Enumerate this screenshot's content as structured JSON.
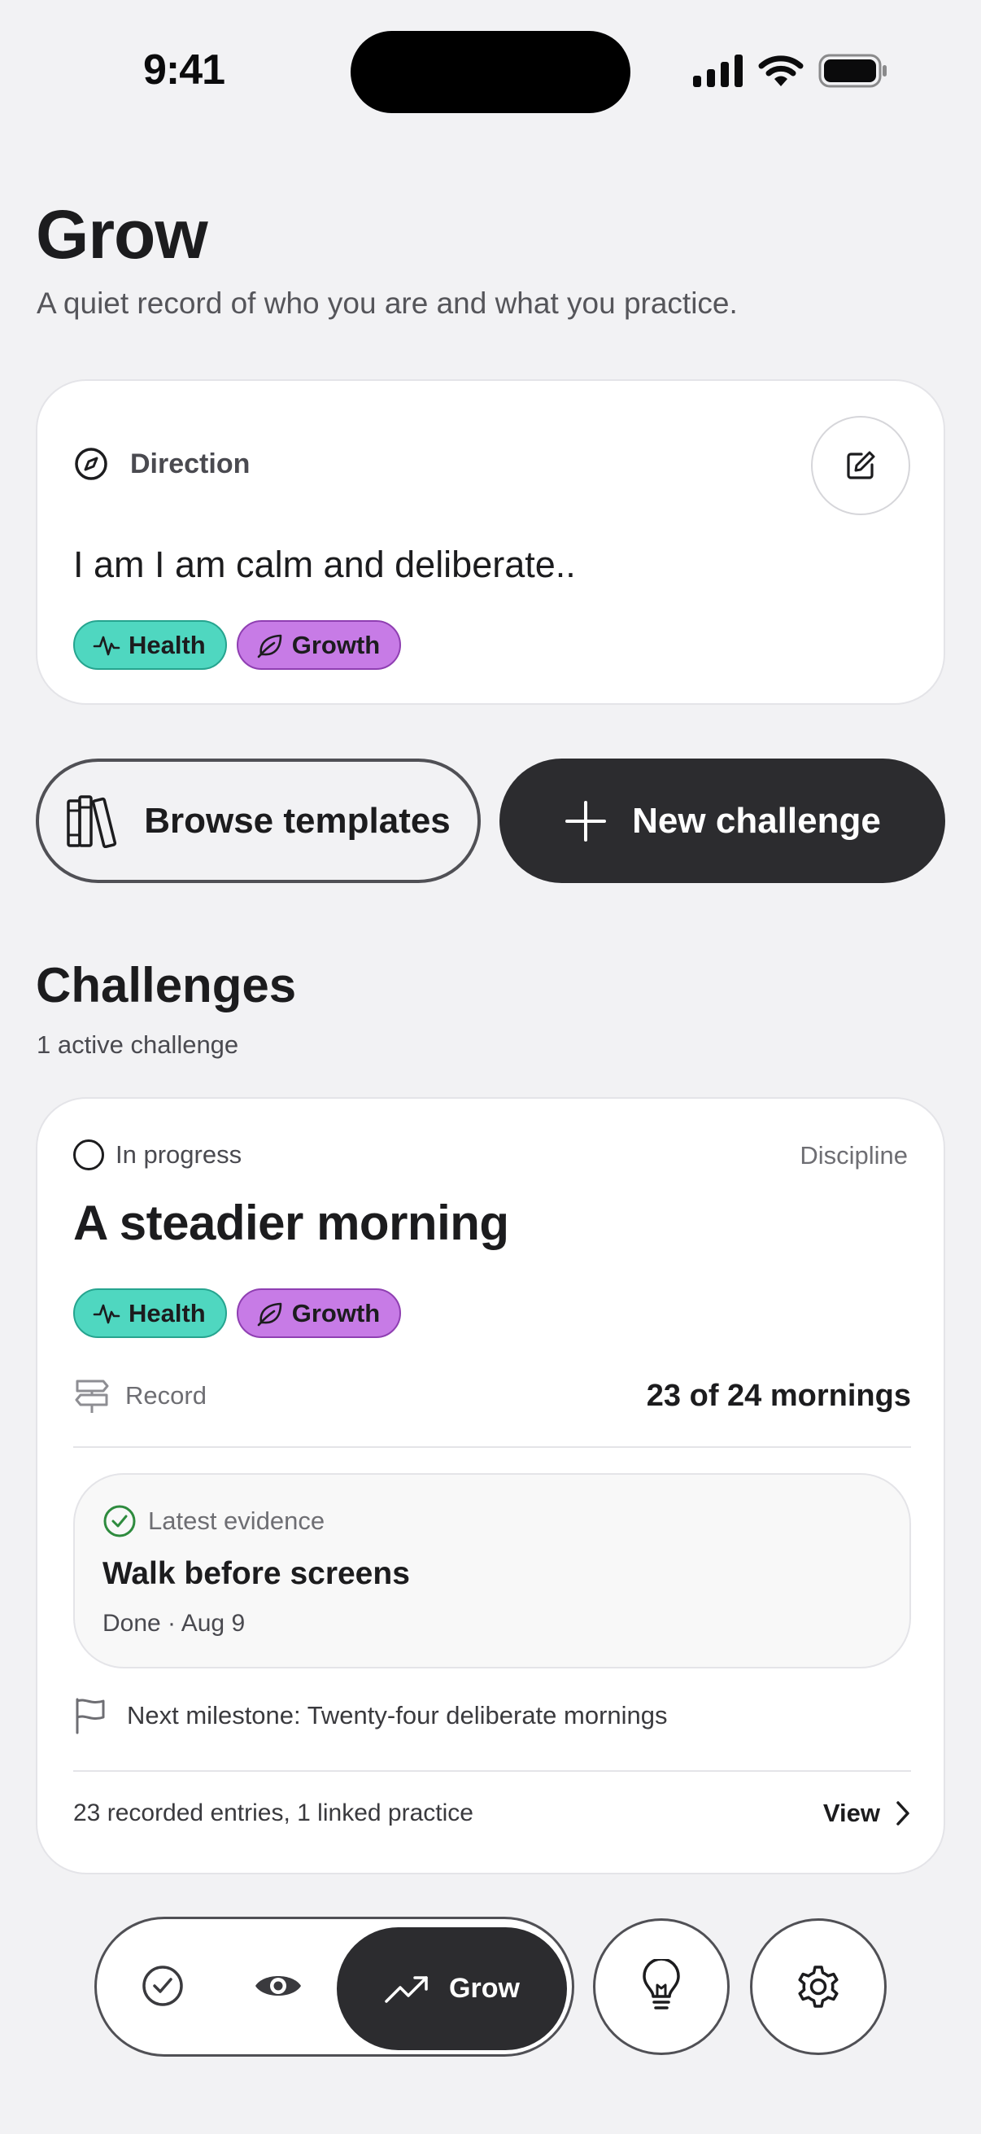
{
  "status_bar": {
    "time": "9:41"
  },
  "header": {
    "title": "Grow",
    "subtitle": "A quiet record of who you are and what you practice."
  },
  "direction": {
    "label": "Direction",
    "statement": "I am I am calm and deliberate..",
    "tags": [
      {
        "label": "Health",
        "icon": "pulse-icon",
        "color": "#4fd7c0"
      },
      {
        "label": "Growth",
        "icon": "leaf-icon",
        "color": "#c77be6"
      }
    ]
  },
  "actions": {
    "browse_label": "Browse templates",
    "new_label": "New challenge"
  },
  "challenges": {
    "title": "Challenges",
    "subtitle": "1 active challenge",
    "items": [
      {
        "status": "In progress",
        "category": "Discipline",
        "title": "A steadier morning",
        "tags": [
          {
            "label": "Health",
            "icon": "pulse-icon"
          },
          {
            "label": "Growth",
            "icon": "leaf-icon"
          }
        ],
        "record_label": "Record",
        "record_count": "23 of 24 mornings",
        "evidence": {
          "label": "Latest evidence",
          "title": "Walk before screens",
          "meta": "Done · Aug 9"
        },
        "milestone": "Next milestone: Twenty-four deliberate mornings",
        "footer": "23 recorded entries, 1 linked practice",
        "view_label": "View"
      }
    ]
  },
  "nav": {
    "active_label": "Grow",
    "items": [
      "check-circle-icon",
      "eye-icon",
      "trend-up-icon",
      "lightbulb-icon",
      "gear-icon"
    ]
  }
}
